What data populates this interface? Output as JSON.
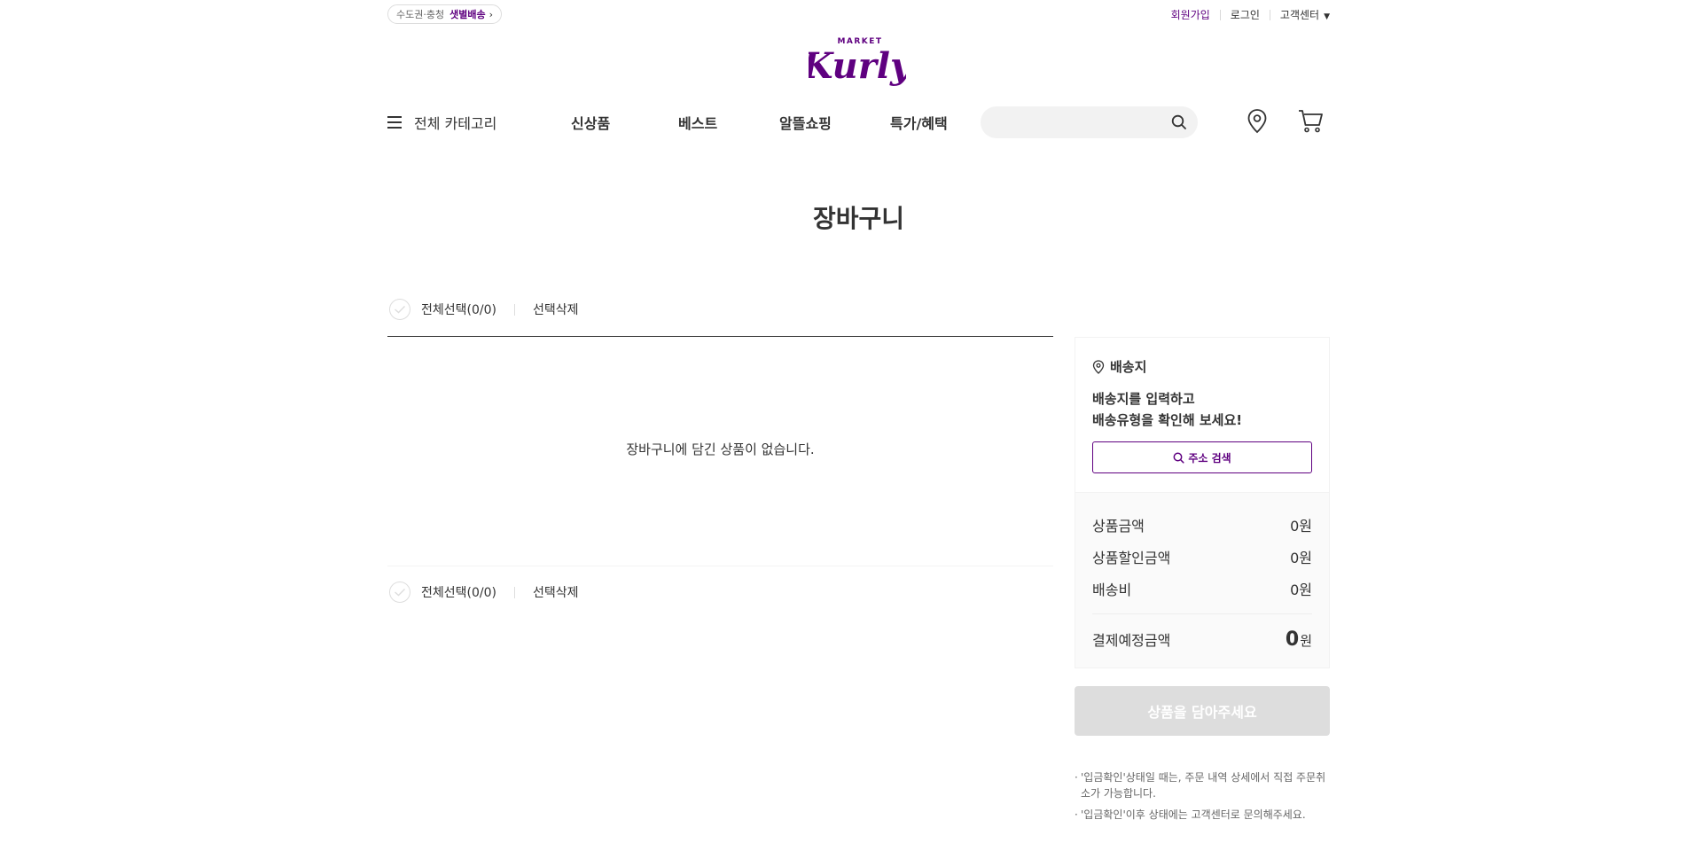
{
  "header": {
    "delivery_region": "수도권·충청",
    "delivery_type": "샛별배송",
    "signup": "회원가입",
    "login": "로그인",
    "customer_center": "고객센터",
    "logo_text": "Kurly",
    "logo_subtext": "MARKET",
    "brand_color": "#5f0080"
  },
  "nav": {
    "category": "전체 카테고리",
    "items": [
      "신상품",
      "베스트",
      "알뜰쇼핑",
      "특가/혜택"
    ],
    "search_placeholder": ""
  },
  "page": {
    "title": "장바구니"
  },
  "cart": {
    "select_all": "전체선택(0/0)",
    "delete_selected": "선택삭제",
    "empty_message": "장바구니에 담긴 상품이 없습니다."
  },
  "address": {
    "heading": "배송지",
    "line1": "배송지를 입력하고",
    "line2": "배송유형을 확인해 보세요!",
    "search_button": "주소 검색"
  },
  "summary": {
    "product_amount_label": "상품금액",
    "product_amount": "0원",
    "discount_label": "상품할인금액",
    "discount": "0원",
    "shipping_label": "배송비",
    "shipping": "0원",
    "total_label": "결제예정금액",
    "total_number": "0",
    "total_unit": "원",
    "order_button": "상품을 담아주세요"
  },
  "notes": [
    "'입금확인'상태일 때는, 주문 내역 상세에서 직접 주문취소가 가능합니다.",
    "'입금확인'이후 상태에는 고객센터로 문의해주세요."
  ]
}
